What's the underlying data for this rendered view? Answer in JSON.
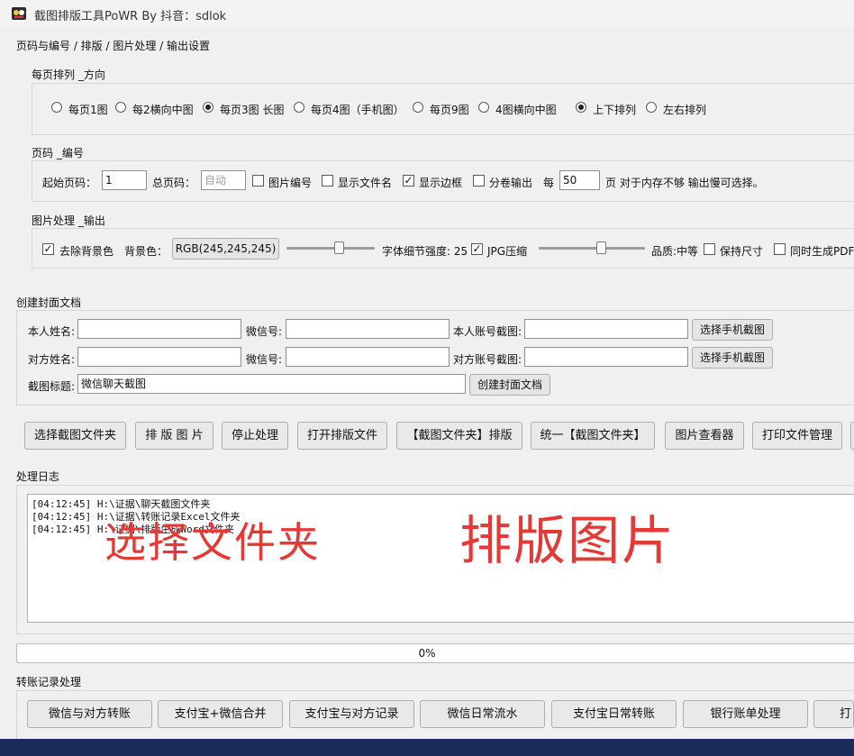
{
  "window": {
    "title": "截图排版工具PoWR By 抖音：sdlok"
  },
  "tabs_label": "页码与编号 / 排版 / 图片处理 / 输出设置",
  "layout_group": {
    "label": "每页排列 _方向",
    "options": [
      "每页1图",
      "每2横向中图",
      "每页3图 长图",
      "每页4图（手机图）",
      "每页9图",
      "4图横向中图"
    ],
    "selected_layout": "每页3图 长图",
    "direction_options": [
      "上下排列",
      "左右排列"
    ],
    "selected_direction": "上下排列"
  },
  "page_group": {
    "label": "页码 _编号",
    "start_page_label": "起始页码：",
    "start_page_value": "1",
    "total_pages_label": "总页码：",
    "total_pages_placeholder": "自动",
    "image_numbering_label": "图片编号",
    "image_numbering_checked": false,
    "show_filename_label": "显示文件名",
    "show_filename_checked": false,
    "show_border_label": "显示边框",
    "show_border_checked": true,
    "split_output_label": "分卷输出",
    "split_output_checked": false,
    "per_label": "每",
    "per_value": "50",
    "per_suffix": "页 对于内存不够 输出慢可选择。"
  },
  "image_group": {
    "label": "图片处理 _输出",
    "remove_bg_label": "去除背景色",
    "remove_bg_checked": true,
    "bg_color_label": "背景色：",
    "bg_color_button": "RGB(245,245,245)",
    "detail_strength_label": "字体细节强度: 25",
    "detail_strength_value": 25,
    "jpg_compress_label": "JPG压缩",
    "jpg_compress_checked": true,
    "quality_label": "品质:中等",
    "keep_size_label": "保持尺寸",
    "keep_size_checked": false,
    "gen_pdf_label": "同时生成PDF",
    "gen_pdf_checked": false
  },
  "cover_group": {
    "label": "创建封面文档",
    "my_name_label": "本人姓名:",
    "wechat_label": "微信号:",
    "my_account_label": "本人账号截图:",
    "pick_phone_button": "选择手机截图",
    "other_name_label": "对方姓名:",
    "other_account_label": "对方账号截图:",
    "title_label": "截图标题:",
    "title_value": "微信聊天截图",
    "create_cover_button": "创建封面文档"
  },
  "action_buttons": [
    "选择截图文件夹",
    "排 版 图 片",
    "停止处理",
    "打开排版文件",
    "【截图文件夹】排版",
    "统一【截图文件夹】",
    "图片查看器",
    "打印文件管理"
  ],
  "log": {
    "label": "处理日志",
    "lines": [
      "[04:12:45] H:\\证据\\聊天截图文件夹",
      "[04:12:45] H:\\证据\\转账记录Excel文件夹",
      "[04:12:45] H:\\证据\\排版生成Word文件夹"
    ],
    "overlay_left": "选择文件夹",
    "overlay_right": "排版图片"
  },
  "progress": {
    "text": "0%",
    "value": 0
  },
  "transfer_group": {
    "label": "转账记录处理",
    "buttons": [
      "微信与对方转账",
      "支付宝+微信合并",
      "支付宝与对方记录",
      "微信日常流水",
      "支付宝日常转账",
      "银行账单处理",
      "打"
    ]
  },
  "colors": {
    "background": "#f0f0f0",
    "overlay_text": "#e53935",
    "taskbar": "#1b2a58"
  }
}
